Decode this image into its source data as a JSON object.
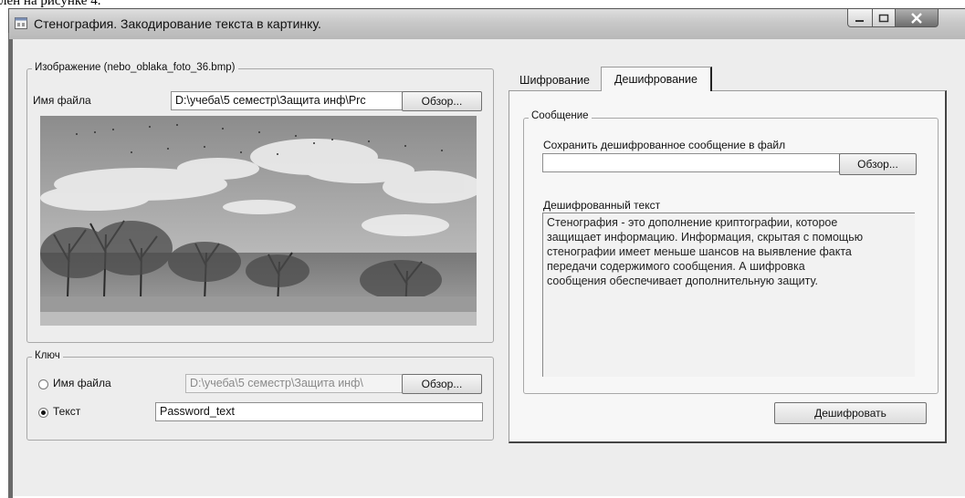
{
  "doc_fragment": "лен на рисунке 4.",
  "window": {
    "title": "Стенография. Закодирование текста в картинку."
  },
  "image_group": {
    "legend": "Изображение (nebo_oblaka_foto_36.bmp)",
    "file_label": "Имя файла",
    "file_path": "D:\\учеба\\5 семестр\\Защита инф\\Prc",
    "browse_label": "Обзор..."
  },
  "key_group": {
    "legend": "Ключ",
    "file_option_label": "Имя файла",
    "file_path": "D:\\учеба\\5 семестр\\Защита инф\\",
    "browse_label": "Обзор...",
    "text_option_label": "Текст",
    "text_value": "Password_text",
    "selected_option": "text"
  },
  "tabs": [
    {
      "label": "Шифрование",
      "active": false
    },
    {
      "label": "Дешифрование",
      "active": true
    }
  ],
  "message_group": {
    "legend": "Сообщение",
    "save_label": "Сохранить дешифрованное сообщение в файл",
    "save_path": "",
    "browse_label": "Обзор...",
    "decoded_label": "Дешифрованный текст",
    "decoded_text": "Стенография - это дополнение криптографии, которое\nзащищает информацию. Информация, скрытая с помощью\nстенографии имеет меньше шансов на выявление факта\nпередачи содержимого сообщения. А шифровка\nсообщения обеспечивает дополнительную защиту."
  },
  "decrypt_button_label": "Дешифровать",
  "icons": {
    "app": "window-app-icon",
    "minimize": "minimize-icon",
    "maximize": "maximize-icon",
    "close": "close-icon"
  }
}
